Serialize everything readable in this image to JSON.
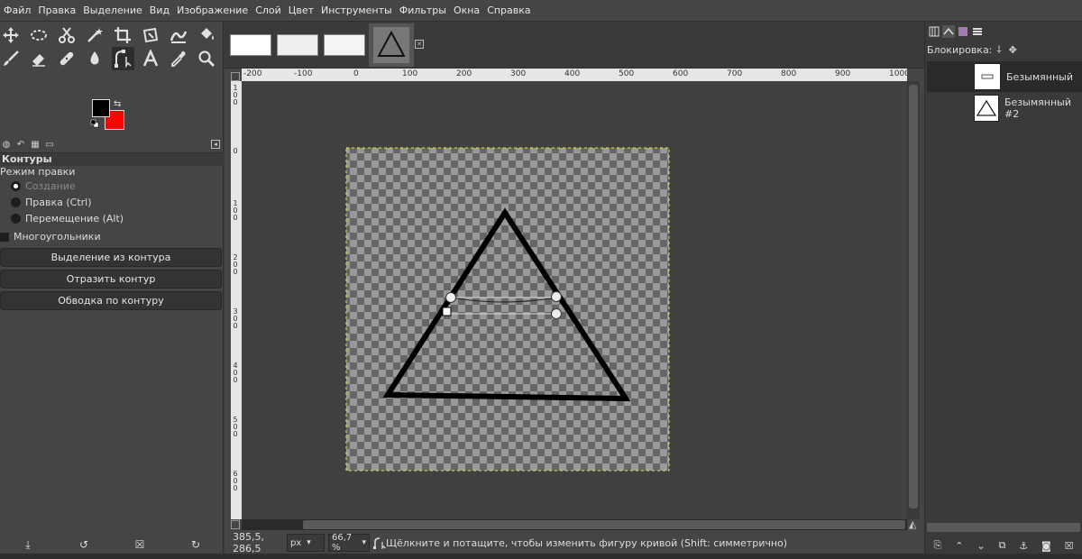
{
  "menu": [
    "Файл",
    "Правка",
    "Выделение",
    "Вид",
    "Изображение",
    "Слой",
    "Цвет",
    "Инструменты",
    "Фильтры",
    "Окна",
    "Справка"
  ],
  "colors": {
    "foreground": "#000000",
    "background": "#ff0000"
  },
  "tool_options": {
    "title": "Контуры",
    "edit_mode_label": "Режим правки",
    "modes": [
      {
        "label": "Создание",
        "checked": true,
        "dim": true
      },
      {
        "label": "Правка (Ctrl)",
        "checked": false,
        "dim": false
      },
      {
        "label": "Перемещение (Alt)",
        "checked": false,
        "dim": false
      }
    ],
    "polygonal_label": "Многоугольники",
    "buttons": [
      "Выделение из контура",
      "Отразить контур",
      "Обводка по контуру"
    ]
  },
  "rulers": {
    "h_marks": [
      "-200",
      "-100",
      "0",
      "100",
      "200",
      "300",
      "400",
      "500",
      "600",
      "700",
      "800",
      "900",
      "1000"
    ],
    "v_marks": [
      "1 0 0",
      "0",
      "1 0 0",
      "2 0 0",
      "3 0 0",
      "4 0 0",
      "5 0 0",
      "6 0 0"
    ]
  },
  "status": {
    "coords": "385,5, 286,5",
    "unit": "px",
    "zoom": "66,7 %",
    "message": "Щёлкните и потащите, чтобы изменить фигуру кривой (Shift: симметрично)"
  },
  "layers": {
    "lock_label": "Блокировка:",
    "items": [
      {
        "name": "Безымянный",
        "selected": true
      },
      {
        "name": "Безымянный #2",
        "selected": false
      }
    ]
  }
}
